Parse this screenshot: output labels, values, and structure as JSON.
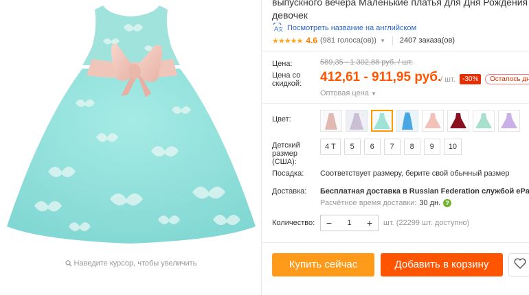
{
  "gallery": {
    "zoom_hint": "Наведите курсор, чтобы увеличить"
  },
  "product": {
    "title_line1": "выпускного вечера Маленькие платья для Дня Рождения для м",
    "title_line2": "девочек",
    "translate_link": "Посмотреть название на английском",
    "stars": "★★★★★",
    "rating": "4.6",
    "votes": "(981 голоса(ов))",
    "orders": "2407 заказа(ов)"
  },
  "pricing": {
    "price_label": "Цена:",
    "old_price": "589,35 - 1 302,88 руб. / шт.",
    "discount_price_label": "Цена со скидкой:",
    "price": "412,61 - 911,95 руб.",
    "per_unit": "/ шт.",
    "discount": "-30%",
    "remaining": "Осталось дн",
    "wholesale": "Оптовая цена"
  },
  "options": {
    "color_label": "Цвет:",
    "swatch_colors": [
      "#e8c9c0",
      "#d8c8d8",
      "#9fe3d8",
      "#5fb8e8",
      "#f2c1b8",
      "#8a1020",
      "#a8e0cf",
      "#c9b0e8"
    ],
    "selected_swatch": 2,
    "size_label": "Детский размер (США):",
    "sizes": [
      "4 T",
      "5",
      "6",
      "7",
      "8",
      "9",
      "10"
    ],
    "fit_label": "Посадка:",
    "fit_text": "Соответствует размеру, берите свой обычный размер"
  },
  "shipping": {
    "label": "Доставка:",
    "text": "Бесплатная доставка в Russian Federation службой ePa",
    "time_label": "Расчётное время доставки:",
    "days": "30 дн."
  },
  "quantity": {
    "label": "Количество:",
    "value": "1",
    "minus": "−",
    "plus": "+",
    "available": "шт. (22299 шт. доступно)"
  },
  "actions": {
    "buy": "Купить сейчас",
    "cart": "Добавить в корзину"
  }
}
